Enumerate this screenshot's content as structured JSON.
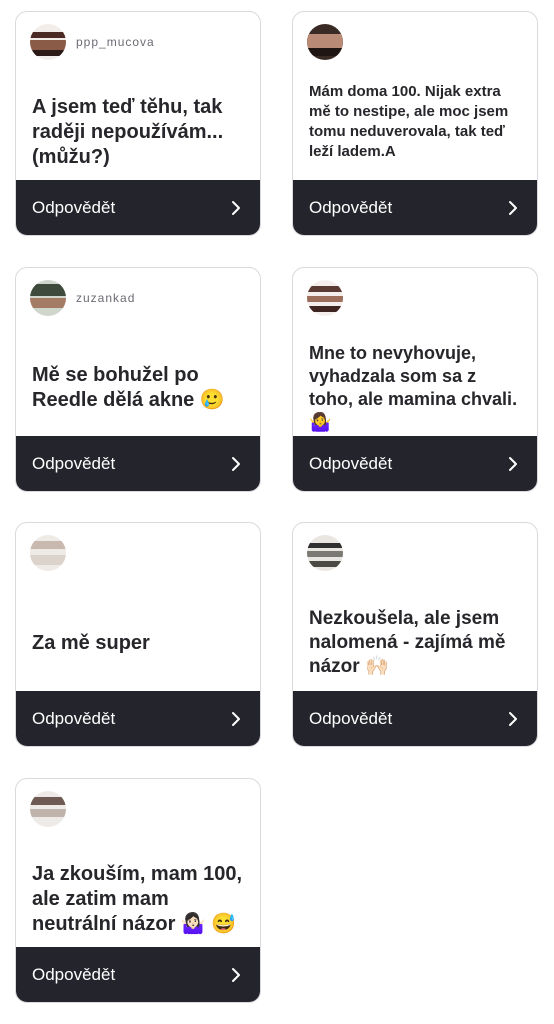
{
  "cards": [
    {
      "username": "ppp_mucova",
      "text": "A jsem teď těhu, tak raději nepoužívám... (můžu?)",
      "reply": "Odpovědět"
    },
    {
      "username": "",
      "text": "Mám doma 100. Nijak extra mě to nestipe, ale moc jsem tomu neduverovala, tak teď leží ladem.A",
      "reply": "Odpovědět"
    },
    {
      "username": "zuzankad",
      "text": "Mě se bohužel po Reedle dělá akne 🥲",
      "reply": "Odpovědět"
    },
    {
      "username": "",
      "text": "Mne to nevyhovuje, vyhadzala som sa z toho, ale mamina chvali. 🤷‍♀️",
      "reply": "Odpovědět"
    },
    {
      "username": "",
      "text": "Za mě super",
      "reply": "Odpovědět"
    },
    {
      "username": "",
      "text": "Nezkoušela, ale jsem nalomená - zajímá mě názor 🙌🏻",
      "reply": "Odpovědět"
    },
    {
      "username": "",
      "text": "Ja zkouším, mam 100, ale zatim mam neutrální názor 🤷🏻‍♀️ 😅",
      "reply": "Odpovědět"
    }
  ],
  "icons": {
    "reply_arrow": "chevron-right-icon"
  },
  "colors": {
    "reply_bar": "#24252c",
    "card_border": "#d9d9de"
  }
}
